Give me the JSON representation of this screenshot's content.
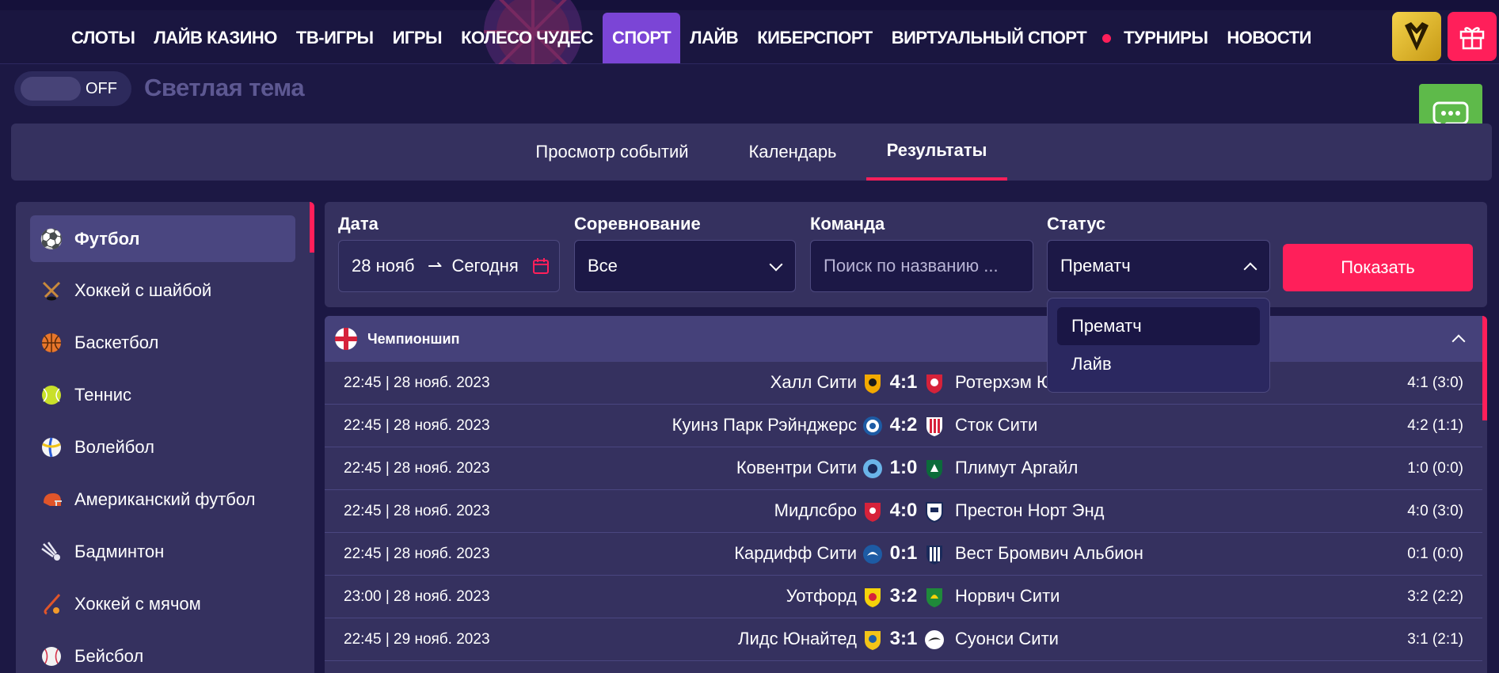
{
  "nav": {
    "items": [
      "СЛОТЫ",
      "ЛАЙВ КАЗИНО",
      "ТВ-ИГРЫ",
      "ИГРЫ",
      "КОЛЕСО ЧУДЕС",
      "СПОРТ",
      "ЛАЙВ",
      "КИБЕРСПОРТ",
      "ВИРТУАЛЬНЫЙ СПОРТ",
      "ТУРНИРЫ",
      "НОВОСТИ"
    ],
    "active": "СПОРТ",
    "accent": "#7b45d6"
  },
  "theme_toggle": {
    "state": "OFF",
    "label": "Светлая тема"
  },
  "tabs": [
    {
      "label": "Просмотр событий"
    },
    {
      "label": "Календарь"
    },
    {
      "label": "Результаты",
      "active": true
    }
  ],
  "sidebar": {
    "items": [
      {
        "label": "Футбол",
        "icon": "soccer-ball-icon"
      },
      {
        "label": "Хоккей с шайбой",
        "icon": "ice-hockey-icon"
      },
      {
        "label": "Баскетбол",
        "icon": "basketball-icon"
      },
      {
        "label": "Теннис",
        "icon": "tennis-ball-icon"
      },
      {
        "label": "Волейбол",
        "icon": "volleyball-icon"
      },
      {
        "label": "Американский футбол",
        "icon": "football-helmet-icon"
      },
      {
        "label": "Бадминтон",
        "icon": "shuttlecock-icon"
      },
      {
        "label": "Хоккей с мячом",
        "icon": "bandy-icon"
      },
      {
        "label": "Бейсбол",
        "icon": "baseball-icon"
      }
    ]
  },
  "filters": {
    "date": {
      "label": "Дата",
      "from": "28 нояб",
      "to": "Сегодня"
    },
    "competition": {
      "label": "Соревнование",
      "value": "Все"
    },
    "team": {
      "label": "Команда",
      "placeholder": "Поиск по названию ..."
    },
    "status": {
      "label": "Статус",
      "value": "Прематч",
      "options": [
        "Прематч",
        "Лайв"
      ]
    },
    "show_button": "Показать"
  },
  "results": {
    "league": "Чемпионшип",
    "matches": [
      {
        "time": "22:45 | 28 нояб. 2023",
        "home": "Халл Сити",
        "score": "4:1",
        "away": "Ротерхэм Юнайтед",
        "final": "4:1 (3:0)"
      },
      {
        "time": "22:45 | 28 нояб. 2023",
        "home": "Куинз Парк Рэйнджерс",
        "score": "4:2",
        "away": "Сток Сити",
        "final": "4:2 (1:1)"
      },
      {
        "time": "22:45 | 28 нояб. 2023",
        "home": "Ковентри Сити",
        "score": "1:0",
        "away": "Плимут Аргайл",
        "final": "1:0 (0:0)"
      },
      {
        "time": "22:45 | 28 нояб. 2023",
        "home": "Мидлсбро",
        "score": "4:0",
        "away": "Престон Норт Энд",
        "final": "4:0 (3:0)"
      },
      {
        "time": "22:45 | 28 нояб. 2023",
        "home": "Кардифф Сити",
        "score": "0:1",
        "away": "Вест Бромвич Альбион",
        "final": "0:1 (0:0)"
      },
      {
        "time": "23:00 | 28 нояб. 2023",
        "home": "Уотфорд",
        "score": "3:2",
        "away": "Норвич Сити",
        "final": "3:2 (2:2)"
      },
      {
        "time": "22:45 | 29 нояб. 2023",
        "home": "Лидс Юнайтед",
        "score": "3:1",
        "away": "Суонси Сити",
        "final": "3:1 (2:1)"
      }
    ]
  }
}
